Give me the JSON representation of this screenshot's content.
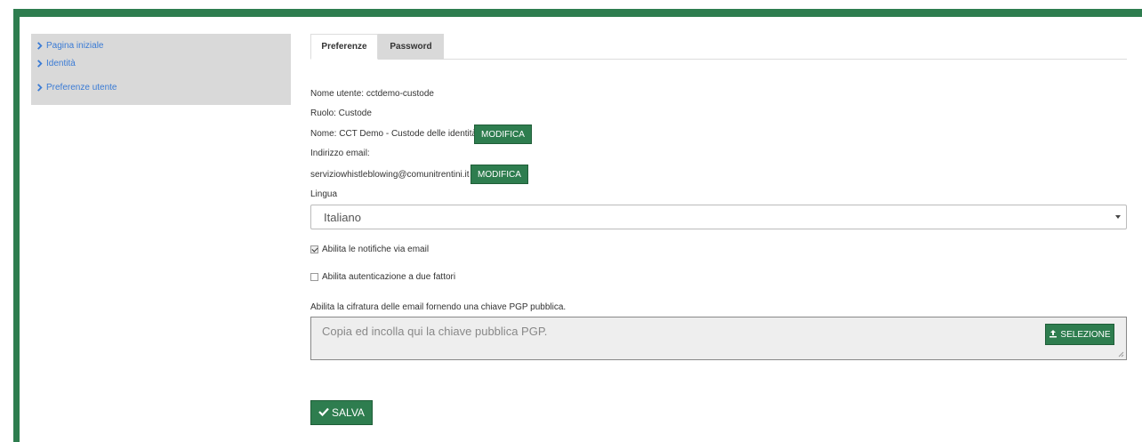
{
  "colors": {
    "accent": "#2e7d4f",
    "link": "#3a7bd5",
    "sidebar_bg": "#d9d9d9"
  },
  "sidebar": {
    "items": [
      {
        "label": "Pagina iniziale",
        "icon": "chevron-right-icon"
      },
      {
        "label": "Identità",
        "icon": "chevron-right-icon"
      },
      {
        "label": "Preferenze utente",
        "icon": "chevron-right-icon"
      }
    ]
  },
  "tabs": [
    {
      "label": "Preferenze",
      "active": true
    },
    {
      "label": "Password",
      "active": false
    }
  ],
  "profile": {
    "username_line": "Nome utente: cctdemo-custode",
    "role_line": "Ruolo: Custode",
    "name_line": "Nome: CCT Demo - Custode delle identità",
    "name_edit_label": "MODIFICA",
    "email_label": "Indirizzo email:",
    "email_value": "serviziowhistleblowing@comunitrentini.it",
    "email_edit_label": "MODIFICA"
  },
  "language": {
    "label": "Lingua",
    "selected": "Italiano"
  },
  "options": {
    "email_notifications": {
      "label": "Abilita le notifiche via email",
      "checked": true
    },
    "two_factor": {
      "label": "Abilita autenticazione a due fattori",
      "checked": false
    }
  },
  "pgp": {
    "label": "Abilita la cifratura delle email fornendo una chiave PGP pubblica.",
    "placeholder": "Copia ed incolla qui la chiave pubblica PGP.",
    "select_button": "SELEZIONE",
    "select_icon": "upload-icon"
  },
  "save": {
    "label": "SALVA",
    "icon": "check-icon"
  }
}
